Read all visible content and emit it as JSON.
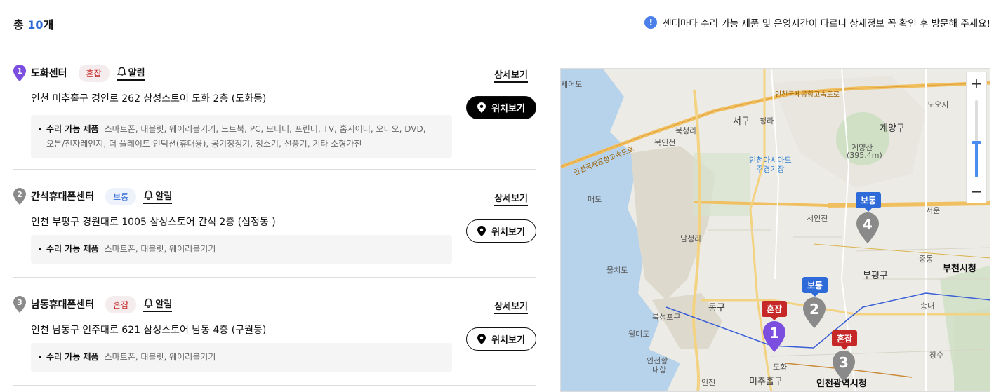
{
  "header": {
    "total_prefix": "총 ",
    "total_count": "10",
    "total_suffix": "개",
    "notice_icon": "!",
    "notice": "센터마다 수리 가능 제품 및 운영시간이 다르니 상세정보 꼭 확인 후 방문해 주세요!"
  },
  "centers": [
    {
      "number": "1",
      "marker_color": "#7b4ee0",
      "name": "도화센터",
      "status": "혼잡",
      "alarm": "알림",
      "detail_link": "상세보기",
      "address": "인천 미추홀구 경인로 262 삼성스토어 도화 2층 (도화동)",
      "location_button": "위치보기",
      "products_label": "수리 가능 제품",
      "products": "스마트폰, 태블릿, 웨어러블기기, 노트북, PC, 모니터, 프린터, TV, 홈시어터, 오디오, DVD,",
      "products_line2": "오븐/전자레인지, 더 플레이트 인덕션(휴대용), 공기청정기, 청소기, 선풍기, 기타 소형가전"
    },
    {
      "number": "2",
      "marker_color": "#8a8a8a",
      "name": "간석휴대폰센터",
      "status": "보통",
      "alarm": "알림",
      "detail_link": "상세보기",
      "address": "인천 부평구 경원대로 1005 삼성스토어 간석 2층 (십정동 )",
      "location_button": "위치보기",
      "products_label": "수리 가능 제품",
      "products": "스마트폰, 태블릿, 웨어러블기기"
    },
    {
      "number": "3",
      "marker_color": "#8a8a8a",
      "name": "남동휴대폰센터",
      "status": "혼잡",
      "alarm": "알림",
      "detail_link": "상세보기",
      "address": "인천 남동구 인주대로 621 삼성스토어 남동 4층 (구월동)",
      "location_button": "위치보기",
      "products_label": "수리 가능 제품",
      "products": "스마트폰, 태블릿, 웨어러블기기"
    }
  ],
  "map": {
    "zoom_in": "+",
    "zoom_out": "−",
    "labels": {
      "seoedo": "세어도",
      "seogu": "서구",
      "cheongna": "청라",
      "bukcheongna": "북청라",
      "bukincheon": "북인천",
      "gyeyanggu": "계양구",
      "gyeyangsan": "계양산",
      "gyeyangsan_height": "(395.4m)",
      "noji": "노오지",
      "incheon_asiad": "인천아시아드",
      "stadium": "주경기장",
      "maedo": "매도",
      "seoincheon": "서인천",
      "namcheongna": "남청라",
      "mulchido": "물치도",
      "seoul": "서운",
      "bupyeonggu": "부평구",
      "jungdong": "중동",
      "bucheon_city_hall": "부천시청",
      "donggu": "동구",
      "bukseongpogu": "북성포구",
      "wolmido": "월미도",
      "incheonhang": "인천항",
      "naehang": "내항",
      "songnae": "송내",
      "michuholgu": "미추홀구",
      "dohwa": "도화",
      "incheon_city_hall": "인천광역시청",
      "incheon": "인천",
      "jangsu": "장수",
      "highway": "인천국제공항고속도로",
      "highway2": "인천국제공항고속도로"
    },
    "pins": [
      {
        "number": "1",
        "status": "혼잡",
        "color": "#7b4ee0"
      },
      {
        "number": "2",
        "status": "보통",
        "color": "#8a8a8a"
      },
      {
        "number": "3",
        "status": "혼잡",
        "color": "#8a8a8a"
      },
      {
        "number": "4",
        "status": "보통",
        "color": "#8a8a8a"
      }
    ]
  }
}
